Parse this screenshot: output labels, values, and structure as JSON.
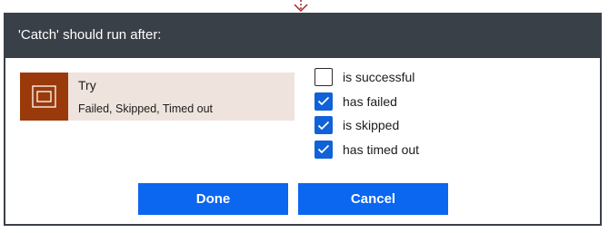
{
  "dialog": {
    "title": "'Catch' should run after:"
  },
  "action": {
    "name": "Try",
    "status": "Failed, Skipped, Timed out",
    "icon": "scope-icon"
  },
  "run_after_options": [
    {
      "label": "is successful",
      "checked": false
    },
    {
      "label": "has failed",
      "checked": true
    },
    {
      "label": "is skipped",
      "checked": true
    },
    {
      "label": "has timed out",
      "checked": true
    }
  ],
  "buttons": {
    "done_label": "Done",
    "cancel_label": "Cancel"
  },
  "colors": {
    "header_bg": "#3a4048",
    "action_icon_bg": "#9a3a0a",
    "action_card_bg": "#efe3dd",
    "checkbox_checked": "#1062d8",
    "button_primary": "#0b66f0",
    "connector": "#a4262c"
  }
}
